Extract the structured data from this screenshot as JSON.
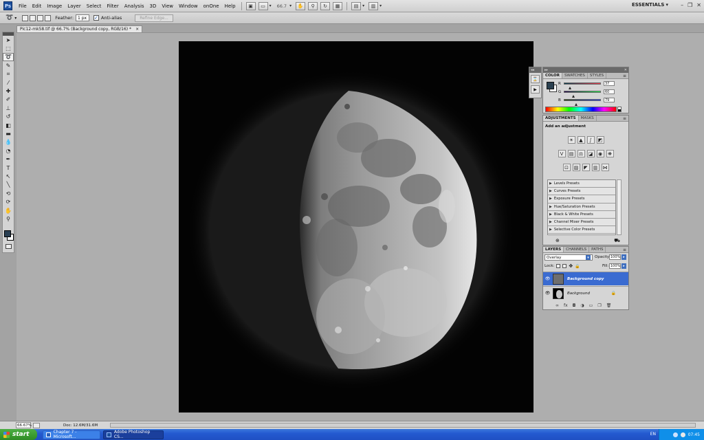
{
  "app": {
    "logo": "Ps",
    "menu": [
      "File",
      "Edit",
      "Image",
      "Layer",
      "Select",
      "Filter",
      "Analysis",
      "3D",
      "View",
      "Window",
      "onOne",
      "Help"
    ],
    "zoom": "66.7",
    "workspace": "ESSENTIALS",
    "window_controls": {
      "minimize": "–",
      "restore": "❐",
      "close": "✕"
    }
  },
  "options_bar": {
    "feather_label": "Feather:",
    "feather_value": "1 px",
    "antialias_label": "Anti-alias",
    "refine_label": "Refine Edge..."
  },
  "document": {
    "tab_title": "Pic12-mk58.tif @ 66.7% (Background copy, RGB/16) *",
    "tab_close": "×"
  },
  "status_bar": {
    "zoom": "66.67%",
    "doc_size": "Doc: 12.6M/31.6M",
    "arrow": "▶"
  },
  "color_panel": {
    "tabs": [
      "COLOR",
      "SWATCHES",
      "STYLES"
    ],
    "r": {
      "label": "R",
      "value": "37"
    },
    "g": {
      "label": "G",
      "value": "60"
    },
    "b": {
      "label": "B",
      "value": "79"
    },
    "fg_color": "#253C4F"
  },
  "adjustments_panel": {
    "tabs": [
      "ADJUSTMENTS",
      "MASKS"
    ],
    "title": "Add an adjustment",
    "presets": [
      "Levels Presets",
      "Curves Presets",
      "Exposure Presets",
      "Hue/Saturation Presets",
      "Black & White Presets",
      "Channel Mixer Presets",
      "Selective Color Presets"
    ]
  },
  "layers_panel": {
    "tabs": [
      "LAYERS",
      "CHANNELS",
      "PATHS"
    ],
    "blend_mode": "Overlay",
    "opacity_label": "Opacity:",
    "opacity_value": "100%",
    "lock_label": "Lock:",
    "fill_label": "Fill:",
    "fill_value": "100%",
    "layers": [
      {
        "name": "Background copy",
        "selected": true
      },
      {
        "name": "Background",
        "selected": false
      }
    ]
  },
  "taskbar": {
    "start": "start",
    "tasks": [
      "Chapter 7 - Microsoft...",
      "Adobe Photoshop CS..."
    ],
    "language": "EN",
    "clock": "07:45"
  }
}
